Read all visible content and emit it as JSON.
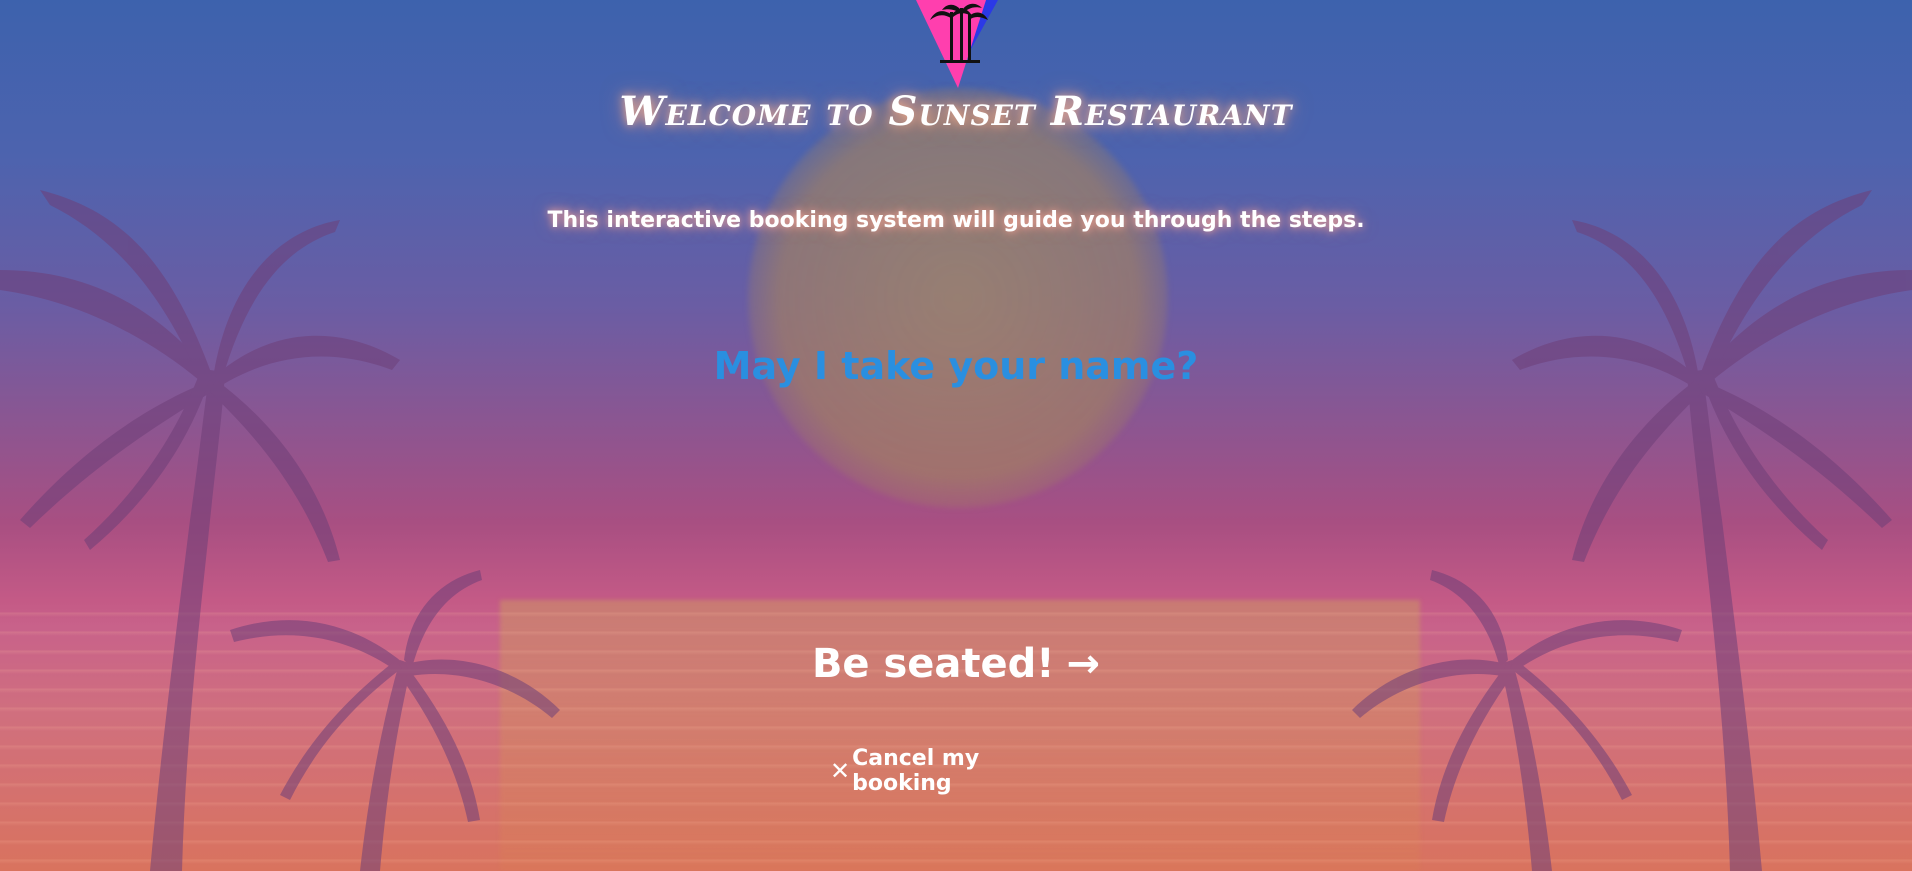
{
  "header": {
    "title": "Welcome to Sunset Restaurant",
    "subtitle": "This interactive booking system will guide you through the steps."
  },
  "form": {
    "name_placeholder": "May I take your name?",
    "name_value": ""
  },
  "actions": {
    "seat_label": "Be seated!",
    "seat_arrow": "→",
    "cancel_icon": "✕",
    "cancel_label": "Cancel my booking"
  },
  "colors": {
    "accent_input": "#2a8fe0",
    "text": "#ffffff",
    "logo_pink": "#ff3fae",
    "logo_blue": "#2b39e6"
  },
  "icons": {
    "logo": "palm-triangle-logo-icon",
    "seat_arrow": "arrow-right-icon",
    "cancel": "close-icon"
  }
}
